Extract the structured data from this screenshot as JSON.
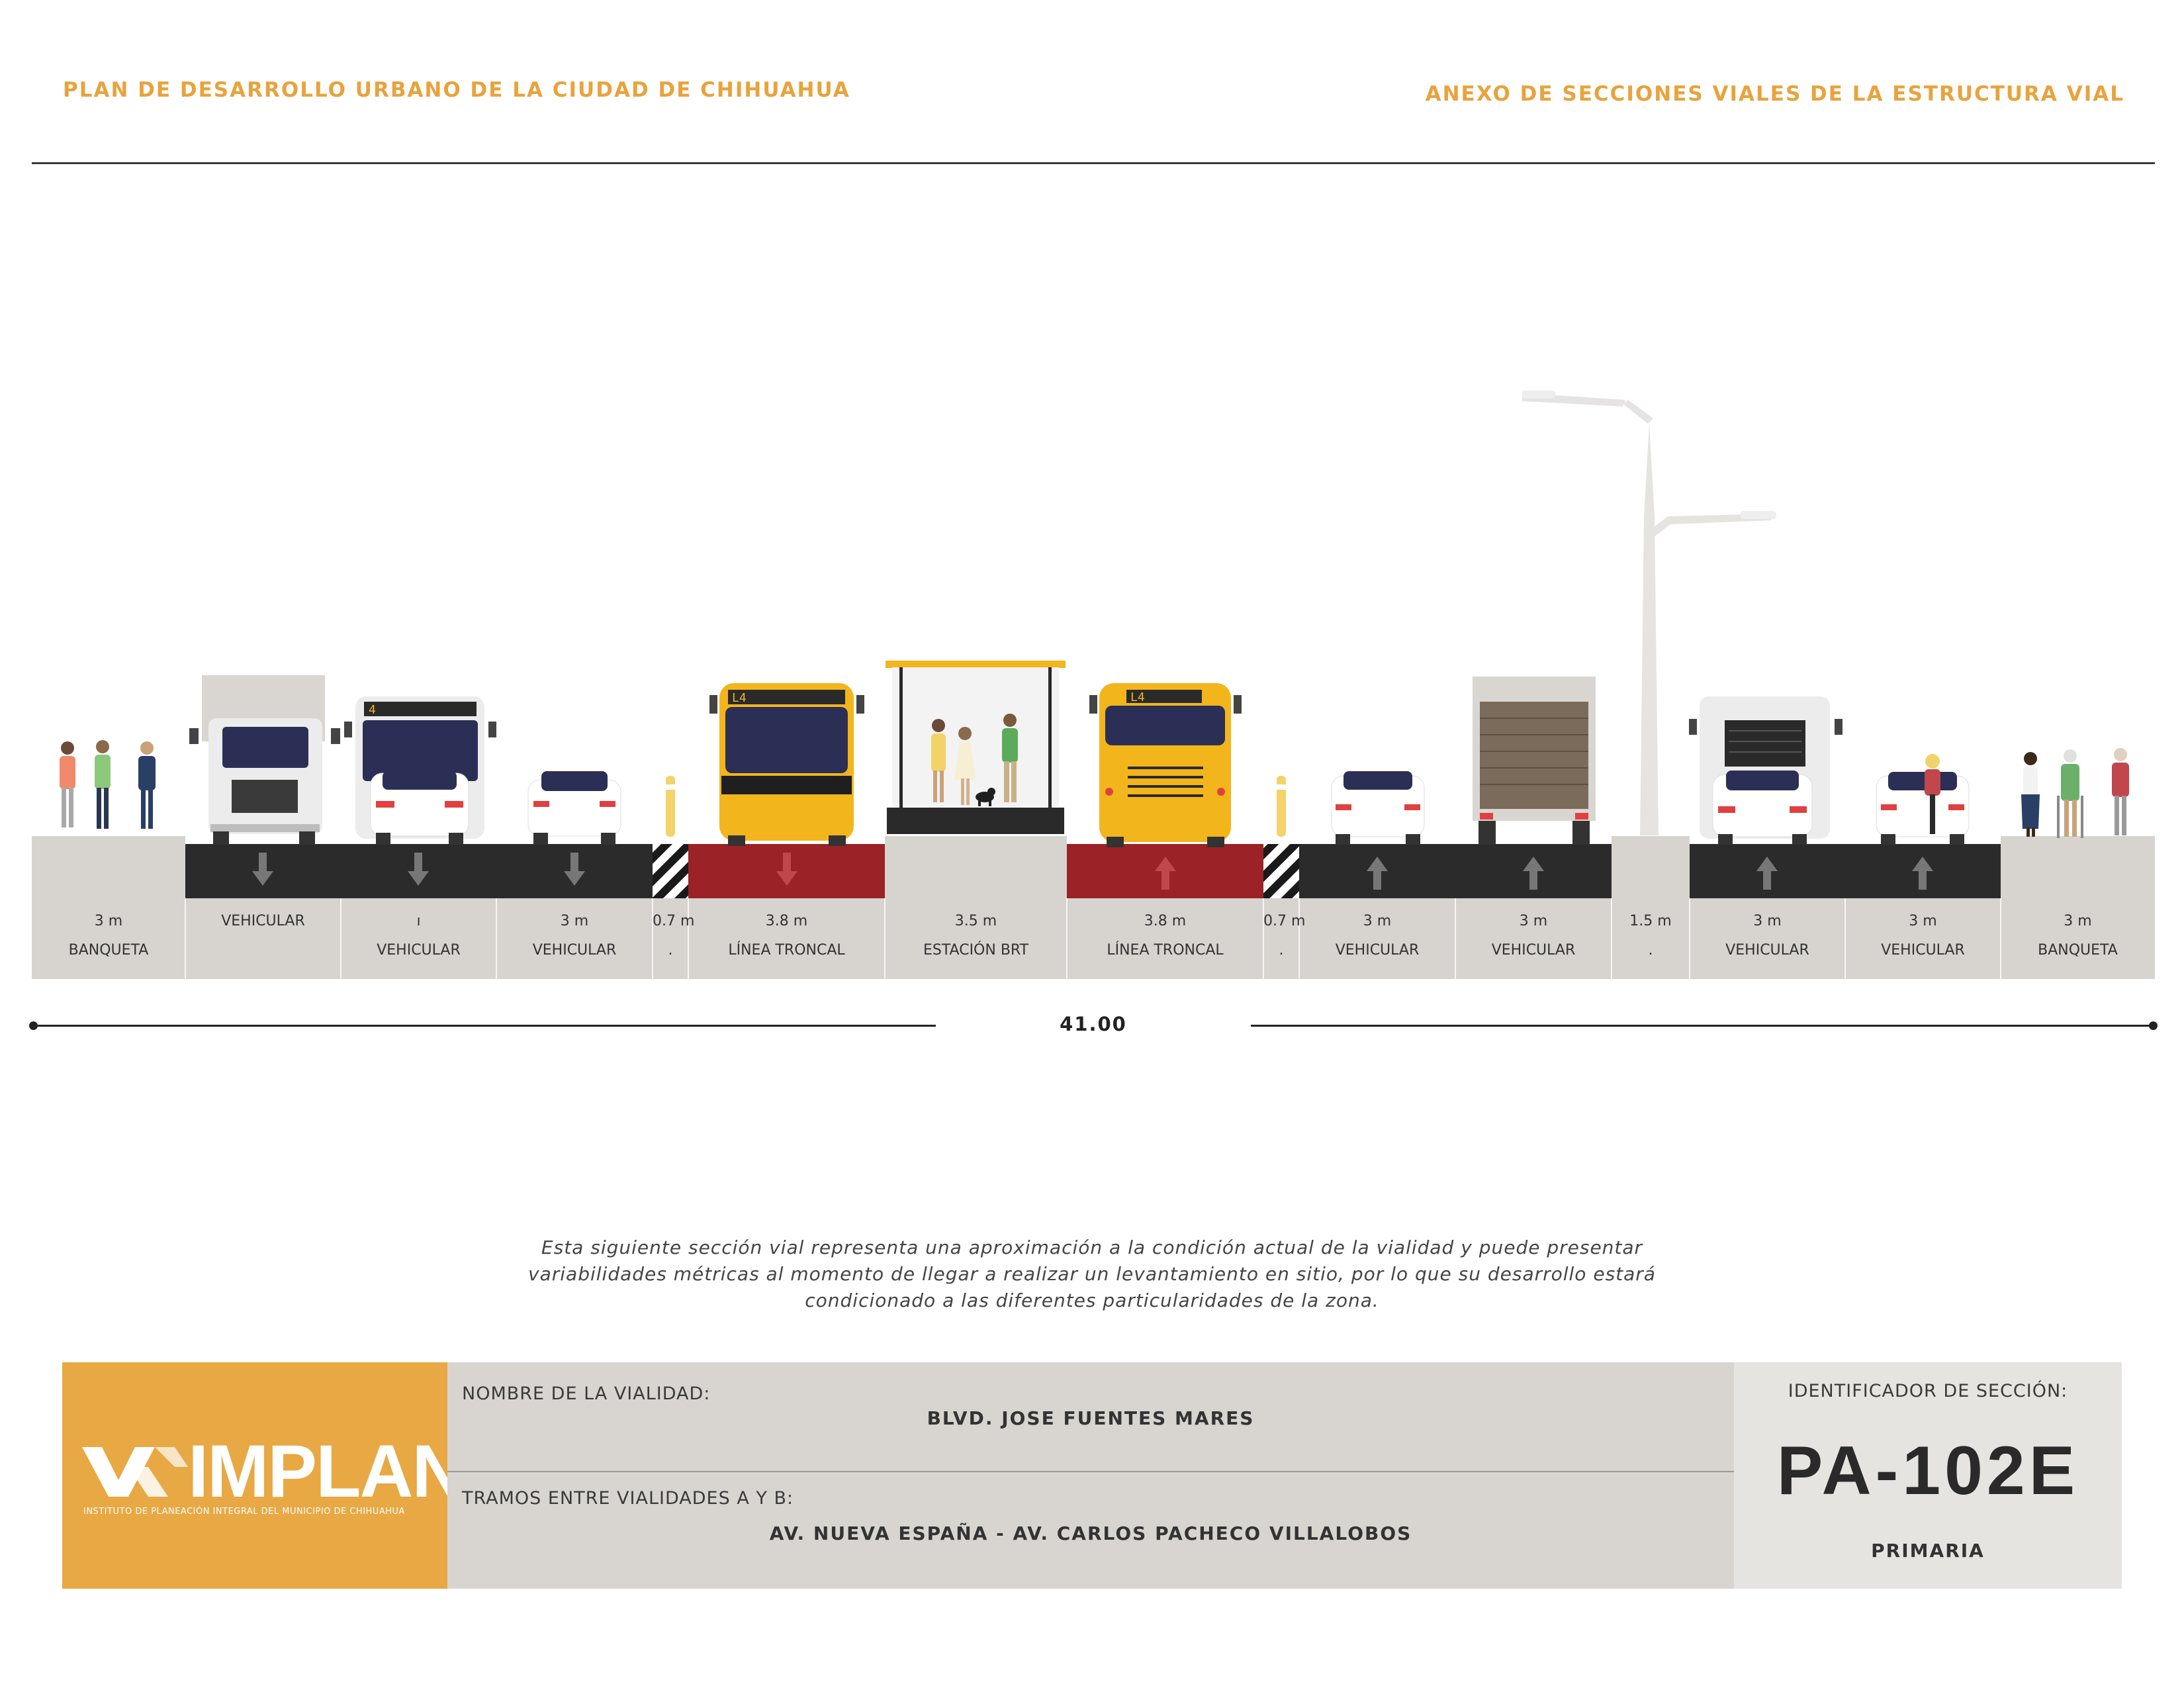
{
  "header": {
    "left_title": "PLAN DE DESARROLLO URBANO DE LA CIUDAD DE CHIHUAHUA",
    "right_title": "ANEXO DE SECCIONES VIALES DE LA ESTRUCTURA VIAL"
  },
  "section": {
    "segments": [
      {
        "width": "3 m",
        "name": "BANQUETA",
        "surface": "sidewalk"
      },
      {
        "width": "",
        "name": "VEHICULAR",
        "surface": "asphalt",
        "arrow": "down"
      },
      {
        "width": "ı",
        "name": "VEHICULAR",
        "surface": "asphalt",
        "arrow": "down"
      },
      {
        "width": "3 m",
        "name": "VEHICULAR",
        "surface": "asphalt",
        "arrow": "down"
      },
      {
        "width": "0.7 m",
        "name": ".",
        "surface": "divider"
      },
      {
        "width": "3.8 m",
        "name": "LÍNEA TRONCAL",
        "surface": "brt",
        "arrow": "down"
      },
      {
        "width": "3.5 m",
        "name": "ESTACIÓN BRT",
        "surface": "station"
      },
      {
        "width": "3.8 m",
        "name": "LÍNEA TRONCAL",
        "surface": "brt",
        "arrow": "up"
      },
      {
        "width": "0.7 m",
        "name": ".",
        "surface": "divider"
      },
      {
        "width": "3 m",
        "name": "VEHICULAR",
        "surface": "asphalt",
        "arrow": "up"
      },
      {
        "width": "3 m",
        "name": "VEHICULAR",
        "surface": "asphalt",
        "arrow": "up"
      },
      {
        "width": "1.5 m",
        "name": ".",
        "surface": "median"
      },
      {
        "width": "3 m",
        "name": "VEHICULAR",
        "surface": "asphalt",
        "arrow": "up"
      },
      {
        "width": "3 m",
        "name": "VEHICULAR",
        "surface": "asphalt",
        "arrow": "up"
      },
      {
        "width": "3 m",
        "name": "BANQUETA",
        "surface": "sidewalk"
      }
    ],
    "total_width": "41.00",
    "bus_line_label": "L4",
    "rear_bus_label": "4",
    "colors": {
      "asphalt": "#2b2b2b",
      "brt": "#9b2226",
      "sidewalk": "#d7d3cf",
      "bus": "#f2b51c",
      "accent": "#e8a33d"
    }
  },
  "note": {
    "lines": [
      "Esta siguiente sección vial representa una aproximación a la condición actual de la vialidad y puede presentar",
      "variabilidades métricas al momento de llegar a realizar un levantamiento en sitio, por lo que su desarrollo estará",
      "condicionado a las diferentes particularidades de la zona."
    ]
  },
  "footer": {
    "logo_text": "IMPLAN",
    "logo_subtitle": "INSTITUTO DE PLANEACIÓN INTEGRAL DEL MUNICIPIO DE CHIHUAHUA",
    "road_name_label": "NOMBRE DE LA VIALIDAD:",
    "road_name": "BLVD. JOSE FUENTES MARES",
    "segment_label": "TRAMOS ENTRE VIALIDADES A Y B:",
    "segment_value": "AV. NUEVA ESPAÑA - AV. CARLOS PACHECO VILLALOBOS",
    "id_label": "IDENTIFICADOR DE SECCIÓN:",
    "id_value": "PA-102E",
    "classification": "PRIMARIA"
  }
}
